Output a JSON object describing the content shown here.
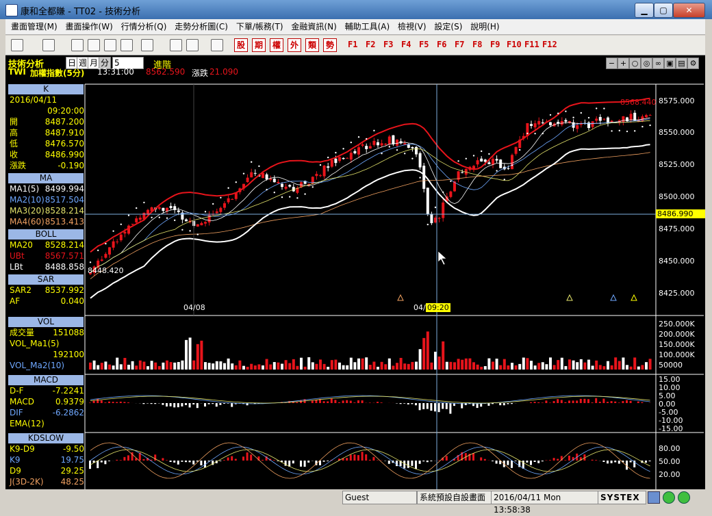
{
  "window": {
    "title": "康和全都賺 - TT02 - 技術分析",
    "min": "▁",
    "max": "▢",
    "close": "✕"
  },
  "menu": [
    "畫面管理(M)",
    "畫面操作(W)",
    "行情分析(Q)",
    "走勢分析圖(C)",
    "下單/帳務(T)",
    "金融資訊(N)",
    "輔助工具(A)",
    "檢視(V)",
    "設定(S)",
    "說明(H)"
  ],
  "toolbar": {
    "categories": [
      "股",
      "期",
      "權",
      "外",
      "類",
      "勢"
    ],
    "fkeys": [
      "F1",
      "F2",
      "F3",
      "F4",
      "F5",
      "F6",
      "F7",
      "F8",
      "F9",
      "F10",
      "F11",
      "F12"
    ]
  },
  "header": {
    "title": "技術分析",
    "periods": [
      "日",
      "週",
      "月",
      "分"
    ],
    "period_n": "5",
    "advanced": "進階",
    "symbol": "TWI",
    "name": "加權指數(5分)",
    "time": "13:31:00",
    "price": "8562.590",
    "change_label": "漲跌",
    "change": "21.090"
  },
  "sidebar": {
    "k": {
      "header": "K",
      "date": "2016/04/11",
      "time": "09:20:00",
      "rows": [
        {
          "label": "開",
          "value": "8487.200"
        },
        {
          "label": "高",
          "value": "8487.910"
        },
        {
          "label": "低",
          "value": "8476.570"
        },
        {
          "label": "收",
          "value": "8486.990"
        },
        {
          "label": "漲跌",
          "value": "-0.190"
        }
      ]
    },
    "ma": {
      "header": "MA",
      "rows": [
        {
          "label": "MA1(5)",
          "value": "8499.994"
        },
        {
          "label": "MA2(10)",
          "value": "8517.504"
        },
        {
          "label": "MA3(20)",
          "value": "8528.214"
        },
        {
          "label": "MA4(60)",
          "value": "8513.413"
        }
      ]
    },
    "boll": {
      "header": "BOLL",
      "rows": [
        {
          "label": "MA20",
          "value": "8528.214"
        },
        {
          "label": "UBt",
          "value": "8567.571"
        },
        {
          "label": "LBt",
          "value": "8488.858"
        }
      ]
    },
    "sar": {
      "header": "SAR",
      "rows": [
        {
          "label": "SAR2",
          "value": "8537.992"
        },
        {
          "label": "AF",
          "value": "0.040"
        }
      ]
    },
    "vol": {
      "header": "VOL",
      "rows": [
        {
          "label": "成交量",
          "value": "151088"
        },
        {
          "label": "VOL_Ma1(5)",
          "value": ""
        },
        {
          "label": "",
          "value": "192100"
        },
        {
          "label": "VOL_Ma2(10)",
          "value": ""
        }
      ]
    },
    "macd": {
      "header": "MACD",
      "rows": [
        {
          "label": "D-F",
          "value": "-7.2241"
        },
        {
          "label": "MACD",
          "value": "0.9379"
        },
        {
          "label": "DIF",
          "value": "-6.2862"
        },
        {
          "label": "EMA(12)",
          "value": ""
        }
      ]
    },
    "kd": {
      "header": "KDSLOW",
      "rows": [
        {
          "label": "K9-D9",
          "value": "-9.50"
        },
        {
          "label": "K9",
          "value": "19.75"
        },
        {
          "label": "D9",
          "value": "29.25"
        },
        {
          "label": "J(3D-2K)",
          "value": "48.25"
        }
      ]
    }
  },
  "price_axis": [
    "8575.000",
    "8550.000",
    "8525.000",
    "8500.000",
    "8475.000",
    "8450.000",
    "8425.000"
  ],
  "price_marks": {
    "high": "8568.440",
    "low": "8448.420",
    "cursor": "8486.990"
  },
  "date_labels": {
    "d1": "04/08",
    "d2": "04/",
    "cursor_time": "09:20"
  },
  "vol_axis": [
    "250.000K",
    "200.000K",
    "150.000K",
    "100.000K",
    "50000"
  ],
  "macd_axis": [
    "15.00",
    "10.00",
    "5.00",
    "0.00",
    "-5.00",
    "-10.00",
    "-15.00"
  ],
  "kd_axis": [
    "80.00",
    "50.00",
    "20.00"
  ],
  "status": {
    "user": "Guest",
    "layout": "系統預設自設畫面",
    "datetime": "2016/04/11 Mon 13:58:38",
    "brand": "SYSTEX"
  },
  "colors": {
    "up": "#e8141b",
    "down": "#ffffff",
    "panel_header": "#9bb7e6",
    "boll_upper": "#e8141b",
    "boll_lower": "#ffffff",
    "accent": "#ffff00"
  },
  "chart_data": {
    "type": "candlestick",
    "ylim": [
      8425,
      8580
    ],
    "series_names": [
      "MA1(5)",
      "MA2(10)",
      "MA3(20)",
      "MA4(60)",
      "UBt",
      "LBt",
      "SAR2"
    ],
    "highlight": {
      "open": 8487.2,
      "high": 8487.91,
      "low": 8476.57,
      "close": 8486.99,
      "time": "09:20"
    }
  }
}
